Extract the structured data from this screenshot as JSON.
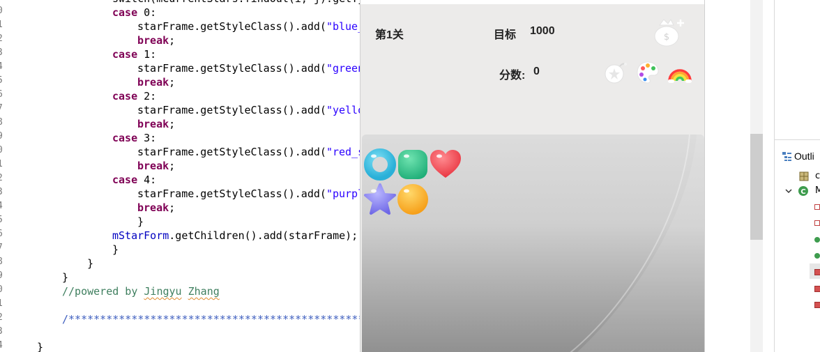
{
  "editor": {
    "line_numbers": [
      "0",
      "1",
      "2",
      "3",
      "4",
      "5",
      "6",
      "7",
      "8",
      "9",
      "0",
      "1",
      "2",
      "3",
      "4",
      "5",
      "6",
      "7",
      "8",
      "9",
      "0",
      "1",
      "2",
      "3",
      "4"
    ],
    "lines": [
      {
        "indent": 161,
        "segments": [
          {
            "t": "switch(mCurrentStars.findOut(i, j).getTyp",
            "c": ""
          }
        ]
      },
      {
        "indent": 161,
        "segments": [
          {
            "t": "case",
            "c": "kw"
          },
          {
            "t": " 0:",
            "c": ""
          }
        ]
      },
      {
        "indent": 197,
        "segments": [
          {
            "t": "starFrame.getStyleClass().add(",
            "c": ""
          },
          {
            "t": "\"blue_",
            "c": "str"
          }
        ]
      },
      {
        "indent": 197,
        "segments": [
          {
            "t": "break",
            "c": "kw"
          },
          {
            "t": ";",
            "c": ""
          }
        ]
      },
      {
        "indent": 161,
        "segments": [
          {
            "t": "case",
            "c": "kw"
          },
          {
            "t": " 1:",
            "c": ""
          }
        ]
      },
      {
        "indent": 197,
        "segments": [
          {
            "t": "starFrame.getStyleClass().add(",
            "c": ""
          },
          {
            "t": "\"green",
            "c": "str"
          }
        ]
      },
      {
        "indent": 197,
        "segments": [
          {
            "t": "break",
            "c": "kw"
          },
          {
            "t": ";",
            "c": ""
          }
        ]
      },
      {
        "indent": 161,
        "segments": [
          {
            "t": "case",
            "c": "kw"
          },
          {
            "t": " 2:",
            "c": ""
          }
        ]
      },
      {
        "indent": 197,
        "segments": [
          {
            "t": "starFrame.getStyleClass().add(",
            "c": ""
          },
          {
            "t": "\"yello",
            "c": "str"
          }
        ]
      },
      {
        "indent": 197,
        "segments": [
          {
            "t": "break",
            "c": "kw"
          },
          {
            "t": ";",
            "c": ""
          }
        ]
      },
      {
        "indent": 161,
        "segments": [
          {
            "t": "case",
            "c": "kw"
          },
          {
            "t": " 3:",
            "c": ""
          }
        ]
      },
      {
        "indent": 197,
        "segments": [
          {
            "t": "starFrame.getStyleClass().add(",
            "c": ""
          },
          {
            "t": "\"red_s",
            "c": "str"
          }
        ]
      },
      {
        "indent": 197,
        "segments": [
          {
            "t": "break",
            "c": "kw"
          },
          {
            "t": ";",
            "c": ""
          }
        ]
      },
      {
        "indent": 161,
        "segments": [
          {
            "t": "case",
            "c": "kw"
          },
          {
            "t": " 4:",
            "c": ""
          }
        ]
      },
      {
        "indent": 197,
        "segments": [
          {
            "t": "starFrame.getStyleClass().add(",
            "c": ""
          },
          {
            "t": "\"purpl",
            "c": "str"
          }
        ]
      },
      {
        "indent": 197,
        "segments": [
          {
            "t": "break",
            "c": "kw"
          },
          {
            "t": ";",
            "c": ""
          }
        ]
      },
      {
        "indent": 197,
        "segments": [
          {
            "t": "}",
            "c": ""
          }
        ]
      },
      {
        "indent": 161,
        "segments": [
          {
            "t": "mStarForm",
            "c": "fld"
          },
          {
            "t": ".getChildren().add(starFrame);",
            "c": ""
          }
        ]
      },
      {
        "indent": 161,
        "segments": [
          {
            "t": "}",
            "c": ""
          }
        ]
      },
      {
        "indent": 125,
        "segments": [
          {
            "t": "}",
            "c": ""
          }
        ]
      },
      {
        "indent": 89,
        "segments": [
          {
            "t": "}",
            "c": ""
          }
        ]
      },
      {
        "indent": 89,
        "segments": [
          {
            "t": "//powered by ",
            "c": "cmt"
          },
          {
            "t": "Jingyu",
            "c": "cmt squig"
          },
          {
            "t": " ",
            "c": "cmt"
          },
          {
            "t": "Zhang",
            "c": "cmt squig"
          }
        ]
      },
      {
        "indent": 89,
        "segments": [
          {
            "t": "",
            "c": ""
          }
        ]
      },
      {
        "indent": 89,
        "segments": [
          {
            "t": "/**********************************************************",
            "c": "doc"
          }
        ]
      },
      {
        "indent": 89,
        "segments": [
          {
            "t": "",
            "c": ""
          }
        ]
      },
      {
        "indent": 53,
        "segments": [
          {
            "t": "}",
            "c": ""
          }
        ]
      }
    ]
  },
  "outline": {
    "title": "Outli",
    "items": [
      {
        "label": "c",
        "icon": "package-icon"
      },
      {
        "label": "M",
        "icon": "class-icon"
      }
    ]
  },
  "game": {
    "level_label": "第1关",
    "target_label": "目标",
    "target_value": "1000",
    "score_label": "分数:",
    "score_value": "0",
    "tools": [
      "money-bag-add-icon",
      "bomb-icon",
      "palette-icon",
      "rainbow-icon"
    ],
    "stars": [
      {
        "row": 0,
        "col": 0,
        "color": "blue",
        "shape": "ring"
      },
      {
        "row": 0,
        "col": 1,
        "color": "green",
        "shape": "square"
      },
      {
        "row": 0,
        "col": 2,
        "color": "red",
        "shape": "heart"
      },
      {
        "row": 1,
        "col": 0,
        "color": "purple",
        "shape": "star"
      },
      {
        "row": 1,
        "col": 1,
        "color": "yellow",
        "shape": "ball"
      }
    ]
  }
}
